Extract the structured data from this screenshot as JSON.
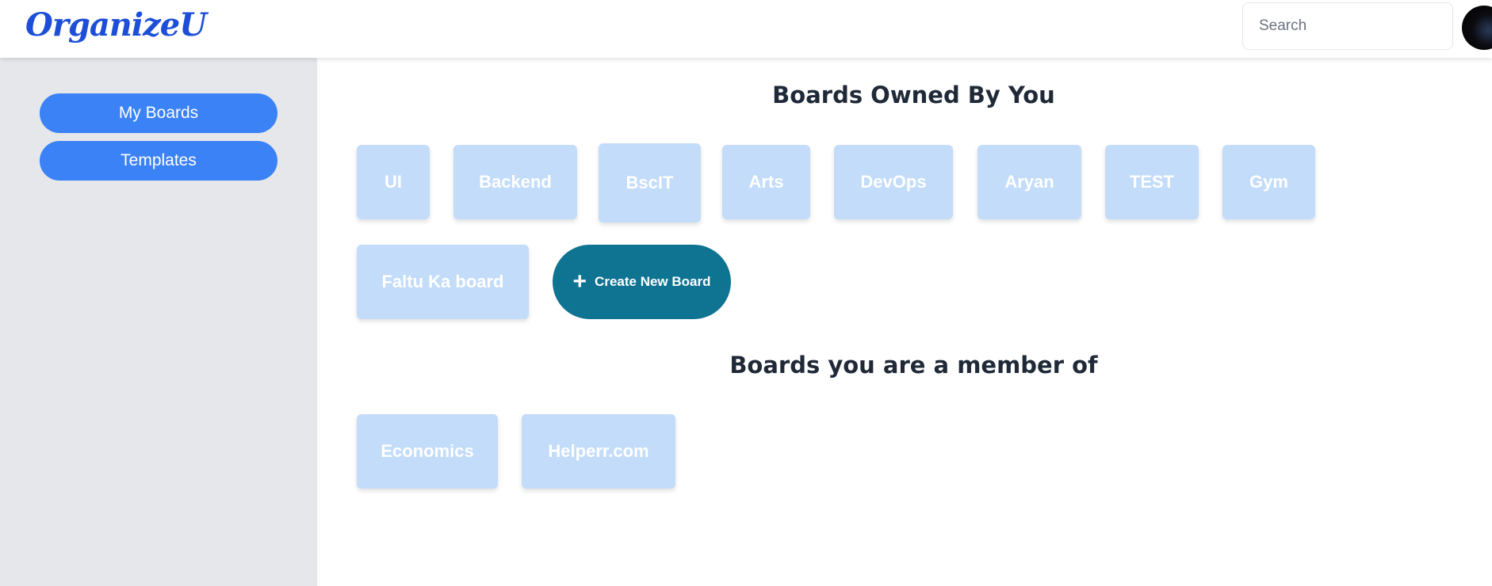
{
  "app": {
    "logo": "OrganizeU"
  },
  "search": {
    "placeholder": "Search"
  },
  "sidebar": {
    "items": [
      {
        "label": "My Boards"
      },
      {
        "label": "Templates"
      }
    ]
  },
  "owned": {
    "title": "Boards Owned By You",
    "boards": [
      "UI",
      "Backend",
      "BscIT",
      "Arts",
      "DevOps",
      "Aryan",
      "TEST",
      "Gym",
      "Faltu Ka board"
    ],
    "create_label": "Create New Board"
  },
  "member": {
    "title": "Boards you are a member of",
    "boards": [
      "Economics",
      "Helperr.com"
    ]
  },
  "colors": {
    "accent": "#3b82f6",
    "logo": "#1d4ed8",
    "board_tile": "#c3dcf9",
    "create_button": "#0f7392",
    "sidebar_bg": "#e5e7eb"
  }
}
